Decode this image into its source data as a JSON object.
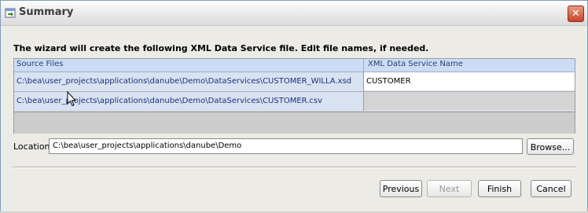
{
  "window": {
    "title": "Summary",
    "close_label": "✕"
  },
  "instruction": "The wizard will create the following XML Data Service file.  Edit file names, if needed.",
  "table": {
    "headers": [
      "Source Files",
      "XML Data Service Name"
    ],
    "rows": [
      {
        "source": "C:\\bea\\user_projects\\applications\\danube\\Demo\\DataServices\\CUSTOMER_WILLA.xsd",
        "name": "CUSTOMER"
      },
      {
        "source": "C:\\bea\\user_projects\\applications\\danube\\Demo\\DataServices\\CUSTOMER.csv",
        "name": ""
      }
    ]
  },
  "location": {
    "label": "Location",
    "value": "C:\\bea\\user_projects\\applications\\danube\\Demo",
    "browse_label": "Browse..."
  },
  "buttons": {
    "previous": "Previous",
    "next": "Next",
    "finish": "Finish",
    "cancel": "Cancel"
  },
  "icons": {
    "app": "wizard-icon",
    "close": "close-icon",
    "cursor": "mouse-pointer-icon"
  },
  "colors": {
    "header_bg": "#ccdcf4",
    "link_text": "#20307a",
    "close_button": "#c8452b"
  }
}
